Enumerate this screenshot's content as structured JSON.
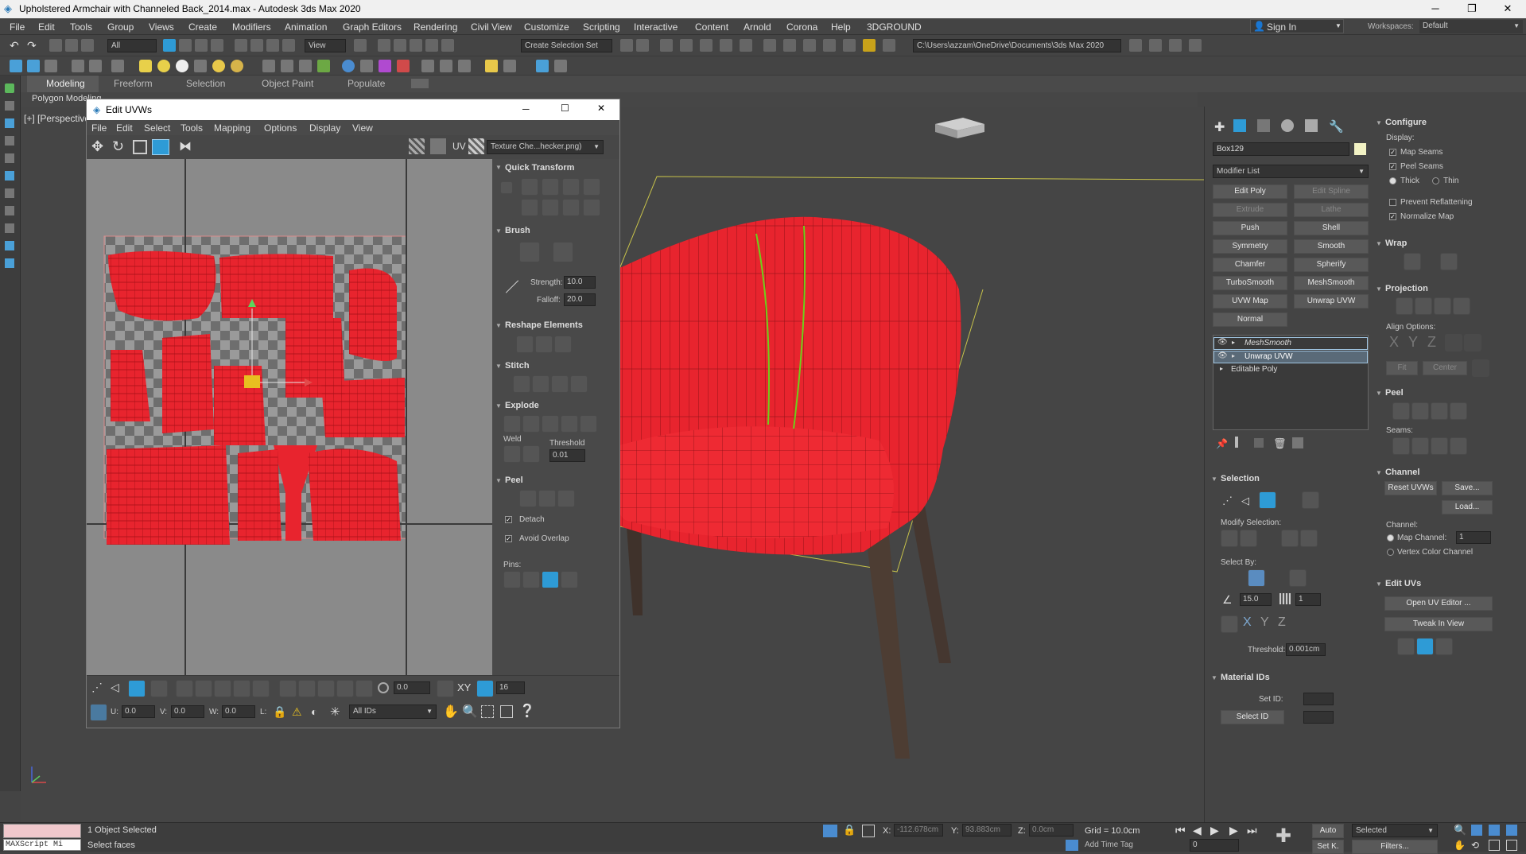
{
  "window": {
    "title": "Upholstered Armchair with Channeled Back_2014.max - Autodesk 3ds Max 2020",
    "minimize": "─",
    "maximize": "❐",
    "close": "✕"
  },
  "menubar": [
    "File",
    "Edit",
    "Tools",
    "Group",
    "Views",
    "Create",
    "Modifiers",
    "Animation",
    "Graph Editors",
    "Rendering",
    "Civil View",
    "Customize",
    "Scripting",
    "Interactive",
    "Content",
    "Arnold",
    "Corona",
    "Help",
    "3DGROUND"
  ],
  "account": {
    "sign_in": "Sign In",
    "workspaces_label": "Workspaces:",
    "workspace": "Default"
  },
  "toolbar": {
    "filter": "All",
    "ref_coord": "View",
    "selection_set": "Create Selection Set",
    "project_path": "C:\\Users\\azzam\\OneDrive\\Documents\\3ds Max 2020"
  },
  "ribbon": {
    "tabs": [
      "Modeling",
      "Freeform",
      "Selection",
      "Object Paint",
      "Populate"
    ],
    "active": "Modeling",
    "sub": "Polygon Modeling"
  },
  "viewport": {
    "label": "[+] [Perspective]"
  },
  "uvw_editor": {
    "title": "Edit UVWs",
    "menu": [
      "File",
      "Edit",
      "Select",
      "Tools",
      "Mapping",
      "Options",
      "Display",
      "View"
    ],
    "uv_label": "UV",
    "texture": "Texture Che...hecker.png)",
    "quick_transform": "Quick Transform",
    "brush": "Brush",
    "strength_label": "Strength:",
    "strength": "10.0",
    "falloff_label": "Falloff:",
    "falloff": "20.0",
    "reshape": "Reshape Elements",
    "stitch": "Stitch",
    "explode": "Explode",
    "weld": "Weld",
    "threshold_label": "Threshold",
    "threshold": "0.01",
    "peel": "Peel",
    "detach": "Detach",
    "avoid_overlap": "Avoid Overlap",
    "pins": "Pins:",
    "spin_value": "0.0",
    "grid_value": "16",
    "u_label": "U:",
    "u": "0.0",
    "v_label": "V:",
    "v": "0.0",
    "w_label": "W:",
    "w": "0.0",
    "l_label": "L:",
    "ids": "All IDs"
  },
  "command_panel": {
    "object_name": "Box129",
    "modifier_list": "Modifier List",
    "buttons": [
      [
        "Edit Poly",
        "Edit Spline"
      ],
      [
        "Extrude",
        "Lathe"
      ],
      [
        "Push",
        "Shell"
      ],
      [
        "Symmetry",
        "Smooth"
      ],
      [
        "Chamfer",
        "Spherify"
      ],
      [
        "TurboSmooth",
        "MeshSmooth"
      ],
      [
        "UVW Map",
        "Unwrap UVW"
      ],
      [
        "Normal",
        ""
      ]
    ],
    "stack": [
      "MeshSmooth",
      "Unwrap UVW",
      "Editable Poly"
    ],
    "selection": "Selection",
    "modify_selection": "Modify Selection:",
    "select_by": "Select By:",
    "angle": "15.0",
    "grow": "1",
    "threshold_label": "Threshold:",
    "threshold": "0.001cm",
    "material_ids": "Material IDs",
    "set_id": "Set ID:",
    "select_id": "Select ID",
    "configure": "Configure",
    "display": "Display:",
    "map_seams": "Map Seams",
    "peel_seams": "Peel Seams",
    "thick": "Thick",
    "thin": "Thin",
    "prevent": "Prevent Reflattening",
    "normalize": "Normalize Map",
    "wrap": "Wrap",
    "projection": "Projection",
    "align_options": "Align Options:",
    "align_axes": [
      "X",
      "Y",
      "Z"
    ],
    "fit": "Fit",
    "center": "Center",
    "peel": "Peel",
    "seams": "Seams:",
    "channel": "Channel",
    "reset_uvws": "Reset UVWs",
    "save": "Save...",
    "load": "Load...",
    "channel_label": "Channel:",
    "map_channel": "Map Channel:",
    "map_channel_value": "1",
    "vertex_color": "Vertex Color Channel",
    "edit_uvs": "Edit UVs",
    "open_uv_editor": "Open UV Editor ...",
    "tweak_in_view": "Tweak In View"
  },
  "status": {
    "script_label": "MAXScript Mi",
    "objects": "1 Object Selected",
    "prompt": "Select faces",
    "x_label": "X:",
    "x": "-112.678cm",
    "y_label": "Y:",
    "y": "93.883cm",
    "z_label": "Z:",
    "z": "0.0cm",
    "grid": "Grid = 10.0cm",
    "add_time_tag": "Add Time Tag",
    "auto": "Auto",
    "selected": "Selected",
    "set_k": "Set K.",
    "filters": "Filters...",
    "frame": "0"
  },
  "colors": {
    "accent": "#2e9bd6",
    "mesh": "#e8242e",
    "seam": "#6fcf1a"
  }
}
